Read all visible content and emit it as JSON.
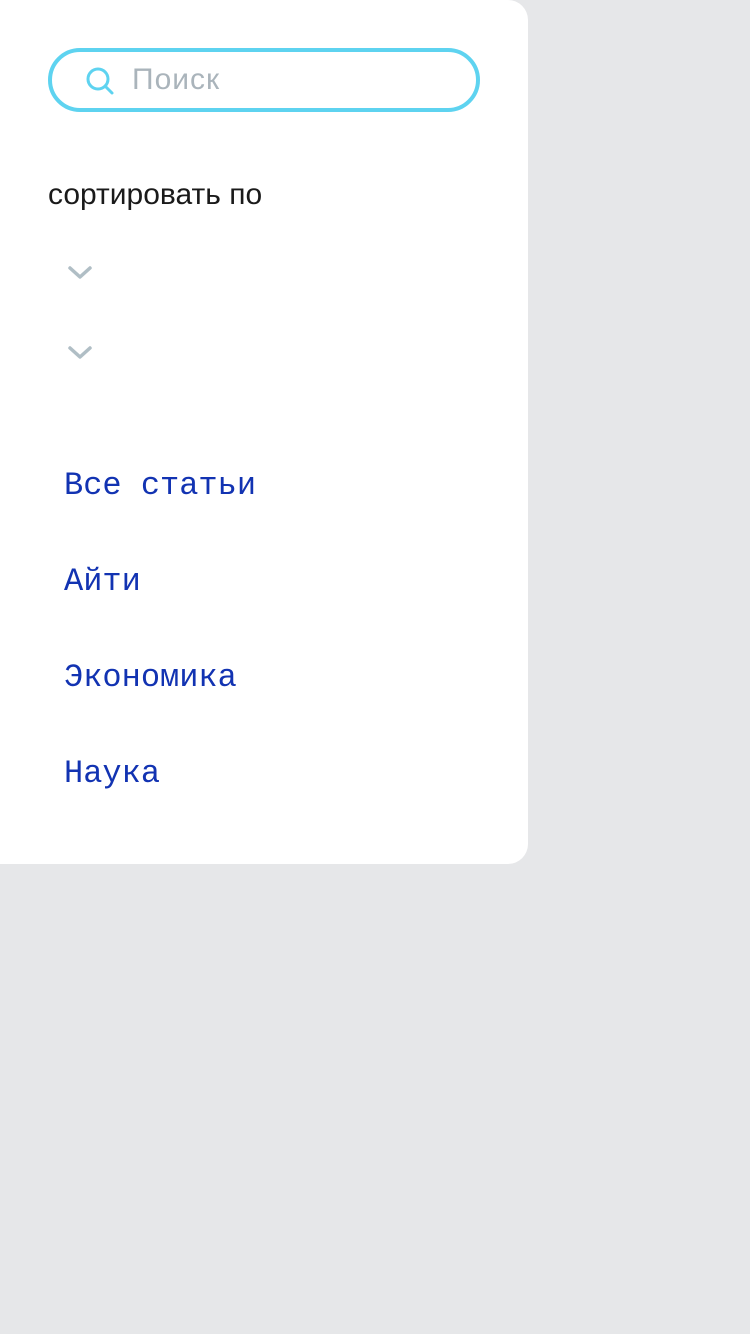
{
  "search": {
    "placeholder": "Поиск",
    "value": "",
    "icon": "search-icon",
    "accent_color": "#5ed3f0"
  },
  "sort": {
    "label": "сортировать по",
    "selects": [
      {
        "value": "",
        "icon": "chevron-down-icon"
      },
      {
        "value": "",
        "icon": "chevron-down-icon"
      }
    ]
  },
  "categories": [
    {
      "label": "Все статьи"
    },
    {
      "label": "Айти"
    },
    {
      "label": "Экономика"
    },
    {
      "label": "Наука"
    }
  ],
  "colors": {
    "link": "#1233b2",
    "background": "#e6e7e9",
    "panel": "#ffffff",
    "chevron": "#b0bec5"
  }
}
